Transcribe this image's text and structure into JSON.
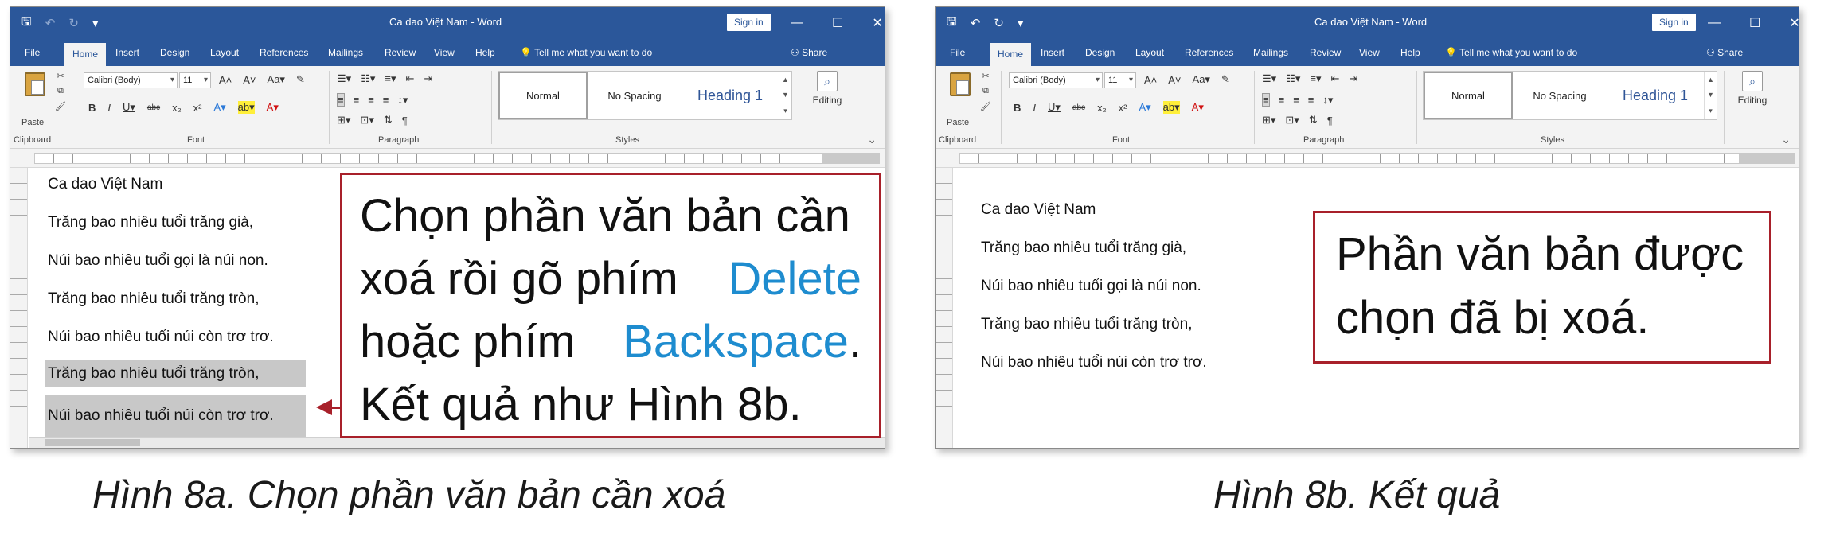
{
  "app": {
    "doc_title": "Ca dao Việt Nam - Word",
    "sign_in": "Sign in",
    "qat": {
      "save": "🖫",
      "undo": "↶",
      "redo": "↻",
      "customize": "▾"
    },
    "window_controls": {
      "restore_ribbon": "▭",
      "minimize": "—",
      "maximize": "☐",
      "close": "✕"
    },
    "tabs": [
      "File",
      "Home",
      "Insert",
      "Design",
      "Layout",
      "References",
      "Mailings",
      "Review",
      "View",
      "Help"
    ],
    "tell_me": "Tell me what you want to do",
    "share": "Share",
    "ribbon": {
      "paste": "Paste",
      "clipboard": "Clipboard",
      "font_name": "Calibri (Body)",
      "font_size": "11",
      "font_group": "Font",
      "paragraph_group": "Paragraph",
      "styles_group": "Styles",
      "styles": [
        "Normal",
        "No Spacing",
        "Heading 1"
      ],
      "editing": "Editing",
      "font_buttons_row1": [
        "A˄",
        "A˅",
        "Aa▾",
        "✎"
      ],
      "font_buttons_row2": [
        "B",
        "I",
        "U▾",
        "abc",
        "x₂",
        "x²",
        "A▾",
        "ab▾",
        "A▾"
      ],
      "para_buttons_row1": [
        "☰▾",
        "☷▾",
        "≡▾",
        "⇤",
        "⇥"
      ],
      "para_buttons_row2": [
        "≡",
        "≡",
        "≡",
        "≡",
        "↕▾",
        "⊞▾",
        "⊡▾",
        "⇅",
        "¶"
      ]
    }
  },
  "doc_lines": [
    "Ca dao Việt Nam",
    "Trăng bao nhiêu tuổi trăng già,",
    "Núi bao nhiêu tuổi gọi là núi non.",
    "Trăng bao nhiêu tuổi trăng tròn,",
    "Núi bao nhiêu tuổi núi còn trơ trơ.",
    "Trăng bao nhiêu tuổi trăng tròn,",
    "Núi bao nhiêu tuổi núi còn trơ trơ."
  ],
  "callout_a": {
    "l1": "Chọn phần văn bản cần",
    "l2a": "xoá rồi gõ phím",
    "l2b": "Delete",
    "l3a": "hoặc phím",
    "l3b": "Backspace",
    "l3c": ".",
    "l4": "Kết quả như Hình 8b."
  },
  "callout_b": {
    "l1": "Phần văn bản được",
    "l2": "chọn đã bị xoá."
  },
  "caption_a": "Hình 8a. Chọn phần văn bản cần xoá",
  "caption_b": "Hình 8b. Kết quả",
  "colors": {
    "title_bar": "#2b579a",
    "callout_border": "#a8202a",
    "keyword": "#1e8ccf",
    "selection": "#c8c8c8"
  }
}
